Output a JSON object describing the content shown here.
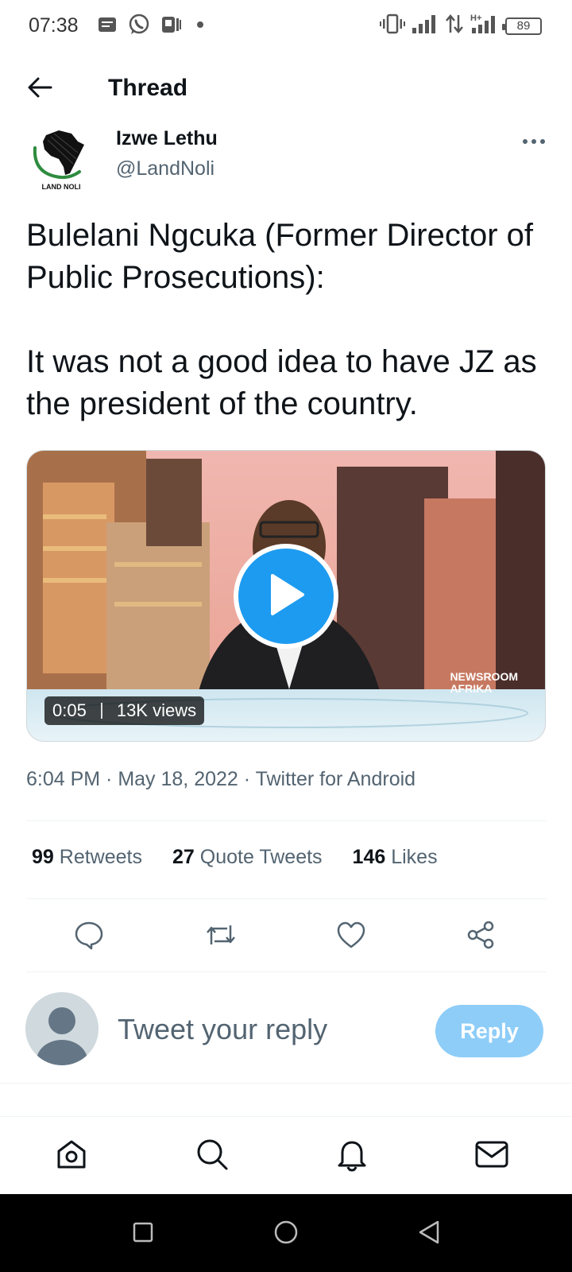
{
  "status_bar": {
    "time": "07:38",
    "battery": "89",
    "left_icons": [
      "message-icon",
      "whatsapp-icon",
      "app-icon",
      "dot-icon"
    ],
    "right_icons": [
      "vibrate-icon",
      "signal-icon",
      "data-arrows-icon",
      "hplus-signal-icon",
      "battery-icon"
    ]
  },
  "header": {
    "title": "Thread"
  },
  "author": {
    "name": "Izwe Lethu",
    "handle": "@LandNoli",
    "logo_text": "LAND NOLI"
  },
  "tweet": {
    "line1": "Bulelani Ngcuka (Former Director of Public Prosecutions):",
    "line2": "It was not a good idea to have JZ as the president of the country."
  },
  "video": {
    "duration": "0:05",
    "views": "13K views",
    "brand_line1": "NEWSROOM",
    "brand_line2": "AFRIKA"
  },
  "meta": {
    "text": "6:04 PM · May 18, 2022 · Twitter for Android"
  },
  "stats": {
    "retweets_count": "99",
    "retweets_label": "Retweets",
    "quotes_count": "27",
    "quotes_label": "Quote Tweets",
    "likes_count": "146",
    "likes_label": "Likes"
  },
  "reply": {
    "placeholder": "Tweet your reply",
    "button": "Reply"
  },
  "colors": {
    "accent": "#1d9bf0",
    "reply_button": "#8ecdf8",
    "muted_text": "#536471"
  }
}
